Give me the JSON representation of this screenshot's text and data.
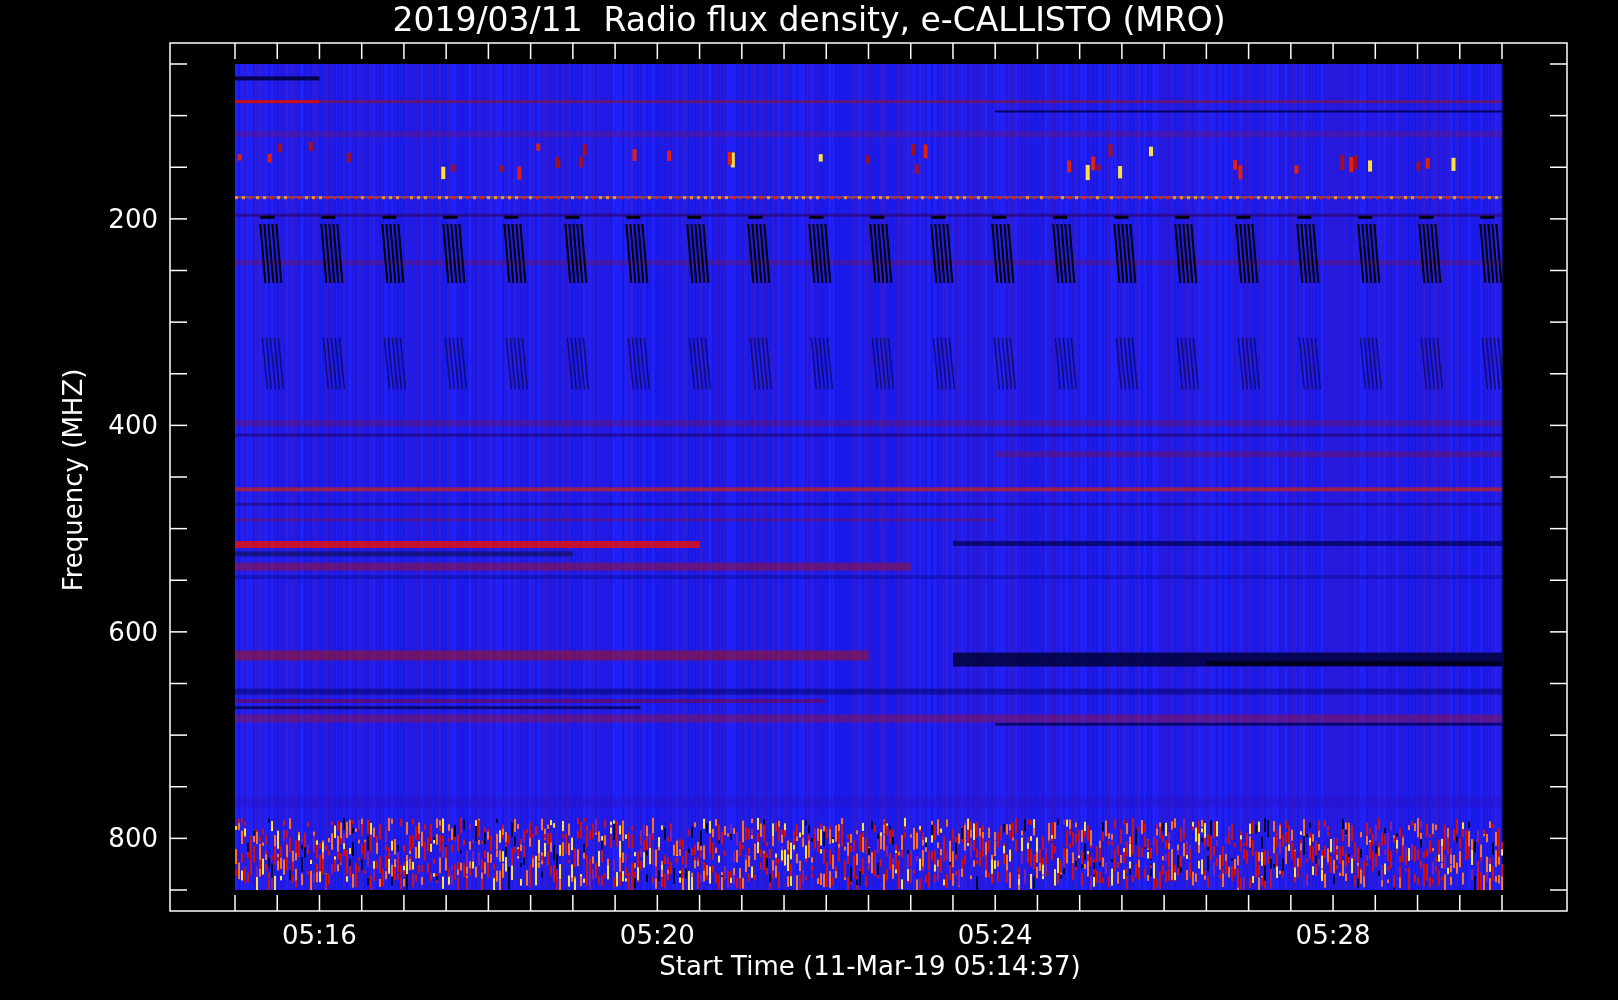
{
  "title": "2019/03/11  Radio flux density, e-CALLISTO (MRO)",
  "plot": {
    "y_axis": {
      "title": "Frequency (MHZ)",
      "tick_labels": [
        "200",
        "400",
        "600",
        "800"
      ]
    },
    "x_axis": {
      "title": "Start Time (11-Mar-19 05:14:37)",
      "tick_labels": [
        "05:16",
        "05:20",
        "05:24",
        "05:28"
      ]
    }
  }
}
